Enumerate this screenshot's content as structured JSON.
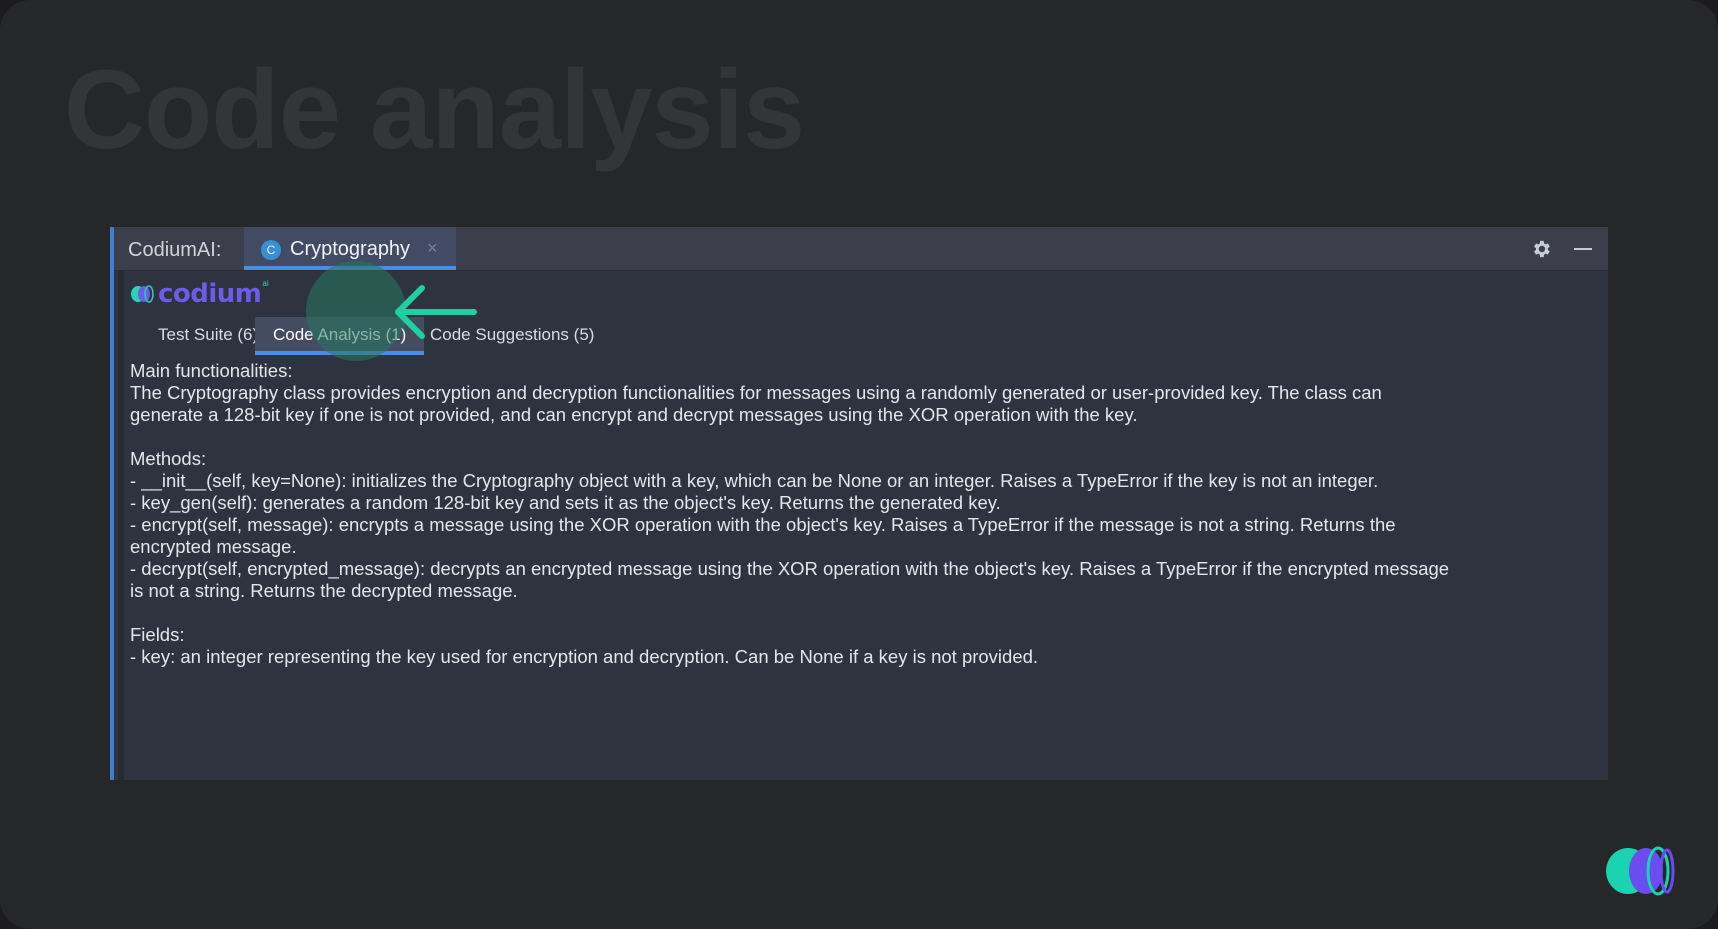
{
  "slide": {
    "title": "Code analysis"
  },
  "tool_window": {
    "label": "CodiumAI:",
    "file_tab": {
      "icon_letter": "C",
      "label": "Cryptography",
      "close": "×"
    },
    "actions": {
      "settings": "gear-icon",
      "minimize": "minimize-icon"
    }
  },
  "logo": {
    "text": "codium",
    "sup": "ai"
  },
  "tabs": [
    {
      "label": "Test Suite (6)",
      "active": false
    },
    {
      "label": "Code Analysis (1)",
      "active": true
    },
    {
      "label": "Code Suggestions (5)",
      "active": false
    }
  ],
  "analysis": {
    "main_heading": "Main functionalities:",
    "main_text": "The Cryptography class provides encryption and decryption functionalities for messages using a randomly generated or user-provided key. The class can generate a 128-bit key if one is not provided, and can encrypt and decrypt messages using the XOR operation with the key.",
    "methods_heading": "Methods:",
    "methods": [
      "- __init__(self, key=None): initializes the Cryptography object with a key, which can be None or an integer. Raises a TypeError if the key is not an integer.",
      "- key_gen(self): generates a random 128-bit key and sets it as the object's key. Returns the generated key.",
      "- encrypt(self, message): encrypts a message using the XOR operation with the object's key. Raises a TypeError if the message is not a string. Returns the encrypted message.",
      "- decrypt(self, encrypted_message): decrypts an encrypted message using the XOR operation with the object's key. Raises a TypeError if the encrypted message is not a string. Returns the decrypted message."
    ],
    "fields_heading": "Fields:",
    "fields": [
      "- key: an integer representing the key used for encryption and decryption. Can be None if a key is not provided."
    ]
  },
  "colors": {
    "accent": "#4a8ee0",
    "annotation": "#1fd1a0",
    "brand": "#6c5ce7"
  }
}
